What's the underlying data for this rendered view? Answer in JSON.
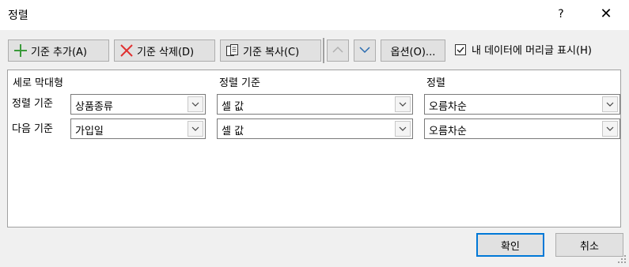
{
  "window": {
    "title": "정렬",
    "help_label": "?",
    "close_label": "✕"
  },
  "toolbar": {
    "add_label": "기준 추가(A)",
    "delete_label": "기준 삭제(D)",
    "copy_label": "기준 복사(C)",
    "options_label": "옵션(O)...",
    "has_header_label": "내 데이터에 머리글 표시(H)",
    "has_header_checked": true
  },
  "grid": {
    "headers": [
      "세로 막대형",
      "정렬 기준",
      "정렬"
    ],
    "rows": [
      {
        "label": "정렬 기준",
        "column": "상품종류",
        "sort_on": "셀 값",
        "order": "오름차순"
      },
      {
        "label": "다음 기준",
        "column": "가입일",
        "sort_on": "셀 값",
        "order": "오름차순"
      }
    ]
  },
  "footer": {
    "ok_label": "확인",
    "cancel_label": "취소"
  },
  "colors": {
    "accent": "#0078d7",
    "add_icon": "#3a9a3a",
    "delete_icon": "#e03030"
  },
  "icons": [
    "plus-icon",
    "x-icon",
    "copy-icon",
    "chevron-up-icon",
    "chevron-down-icon",
    "check-icon",
    "resize-grip-icon"
  ]
}
